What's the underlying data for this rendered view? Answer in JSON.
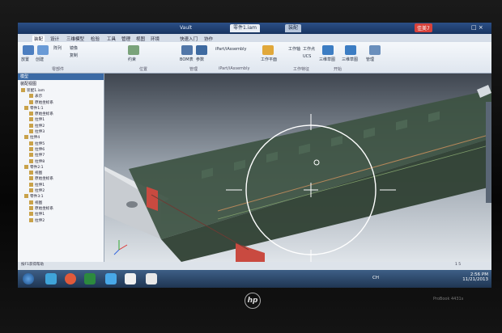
{
  "app": {
    "title_tab": "Vault",
    "menu": [
      "装配",
      "设计",
      "三维模型",
      "检验",
      "工具",
      "管理",
      "视图",
      "环境",
      "快速入门",
      "协作"
    ],
    "document_tab": "零件1.iam",
    "document_tab2": "装配",
    "user_badge": "佳美7",
    "window_controls": "□ ×"
  },
  "ribbon": {
    "buttons": [
      "放置",
      "创建",
      "阵列",
      "镜像",
      "复制",
      "约束",
      "BOM表",
      "参数",
      "iPart/iAssembly",
      "工作平面",
      "工作轴",
      "工作点",
      "UCS",
      "三维草图",
      "三维草图",
      "管理"
    ],
    "groups": [
      "零部件",
      "位置",
      "管理",
      "iPart/iAssembly",
      "工作特征",
      "开始"
    ]
  },
  "sidebar": {
    "header": "模型",
    "filter_label": "装配视图",
    "tree_items": [
      "装配1.iam",
      "表示",
      "原始坐标系",
      "零件1:1",
      "原始坐标系",
      "拉伸1",
      "拉伸2",
      "拉伸3",
      "拉伸4",
      "拉伸5",
      "拉伸6",
      "拉伸7",
      "拉伸8",
      "零件2:1",
      "视图",
      "原始坐标系",
      "拉伸1",
      "拉伸2",
      "零件3:1",
      "视图",
      "原始坐标系",
      "拉伸1",
      "拉伸2"
    ]
  },
  "statusbar": {
    "left": "按F1获得帮助",
    "right": "1 5"
  },
  "taskbar": {
    "lang": "CH",
    "time": "2:56 PM",
    "date": "11/21/2013"
  },
  "bezel": {
    "brand": "hp",
    "model": "ProBook 4431s"
  },
  "colors": {
    "ribbon_blue": "#2b4f86",
    "rail": "#3d5242",
    "red_plate": "#c94a40"
  }
}
